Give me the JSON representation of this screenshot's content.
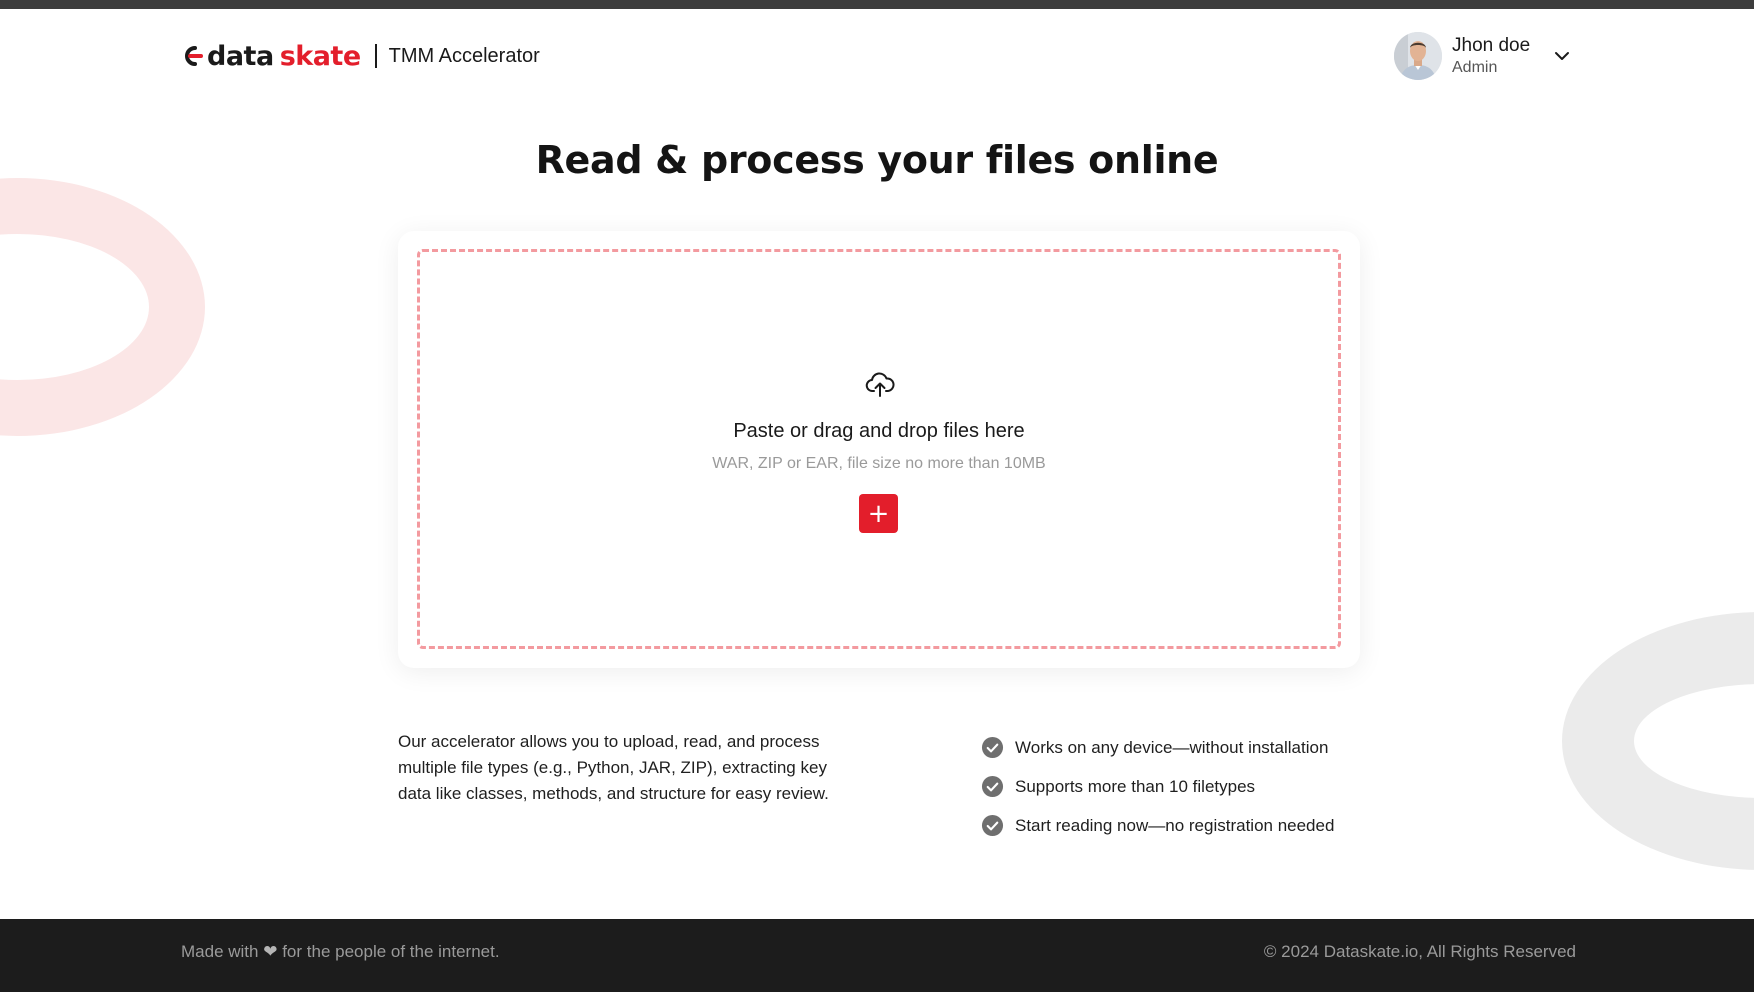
{
  "colors": {
    "brand_red": "#e31e2b",
    "dropzone_border": "#f39a9f",
    "footer_bg": "#1c1c1c",
    "ring_left": "#fbe6e6",
    "ring_right": "#ebebeb"
  },
  "header": {
    "logo": {
      "part1": "data",
      "part2": "skate"
    },
    "product_name": "TMM Accelerator",
    "user": {
      "name": "Jhon doe",
      "role": "Admin",
      "avatar_icon": "user-avatar-photo",
      "menu_icon": "chevron-down-icon"
    }
  },
  "main": {
    "title": "Read & process your files online",
    "upload": {
      "icon": "cloud-upload-icon",
      "title": "Paste or drag and drop files here",
      "hint": "WAR, ZIP or EAR, file size no more than 10MB",
      "add_button_label": "+"
    },
    "description": "Our accelerator allows you to upload, read, and process multiple file types (e.g., Python, JAR, ZIP), extracting key data like classes, methods, and structure for easy review.",
    "features": [
      {
        "icon": "check-circle-icon",
        "text": "Works on any device—without installation"
      },
      {
        "icon": "check-circle-icon",
        "text": "Supports more than 10 filetypes"
      },
      {
        "icon": "check-circle-icon",
        "text": "Start reading now—no registration needed"
      }
    ]
  },
  "footer": {
    "made_with_prefix": "Made with",
    "heart": "❤",
    "made_with_suffix": "for the people of the internet.",
    "copyright": "© 2024 Dataskate.io, All Rights Reserved"
  }
}
